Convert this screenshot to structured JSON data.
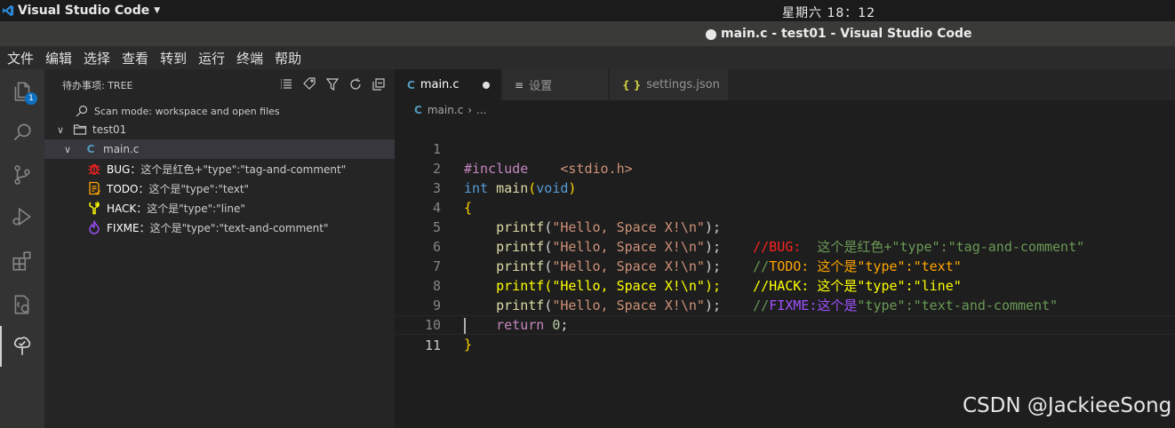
{
  "topbar": {
    "app_name": "Visual Studio Code",
    "clock": "星期六 18：12"
  },
  "window": {
    "title": "main.c - test01 - Visual Studio Code"
  },
  "menu": [
    "文件",
    "编辑",
    "选择",
    "查看",
    "转到",
    "运行",
    "终端",
    "帮助"
  ],
  "activity": {
    "explorer_badge": "1"
  },
  "sidebar": {
    "header": "待办事项: TREE",
    "scan_mode": "Scan mode: workspace and open files",
    "folder": "test01",
    "file": "main.c",
    "items": [
      {
        "tag": "BUG：",
        "text": " 这个是红色+\"type\":\"tag-and-comment\"",
        "color": "#ff2020"
      },
      {
        "tag": "TODO：",
        "text": "这个是\"type\":\"text\"",
        "color": "#ffa500"
      },
      {
        "tag": "HACK：",
        "text": "这个是\"type\":\"line\"",
        "color": "#ffff00"
      },
      {
        "tag": "FIXME：",
        "text": "这个是\"type\":\"text-and-comment\"",
        "color": "#a050ff"
      }
    ]
  },
  "tabs": [
    {
      "icon": "C",
      "label": "main.c",
      "dirty": true
    },
    {
      "icon": "≡",
      "label": "设置",
      "dirty": false
    },
    {
      "icon": "{ }",
      "label": "settings.json",
      "dirty": false
    }
  ],
  "breadcrumb": {
    "file": "main.c",
    "rest": "..."
  },
  "code": {
    "line_numbers": [
      "1",
      "2",
      "3",
      "4",
      "5",
      "6",
      "7",
      "8",
      "9",
      "10",
      "11"
    ],
    "include_kw": "#include",
    "include_file": "<stdio.h>",
    "int_kw": "int",
    "main_fn": "main",
    "void_kw": "void",
    "printf_fn": "printf",
    "hello_str": "\"Hello, Space X!\\n\"",
    "return_kw": "return",
    "zero": "0",
    "c_bug_prefix": "//BUG:",
    "c_bug_body": "  这个是红色+\"type\":\"tag-and-comment\"",
    "c_todo_prefix": "//",
    "c_todo_tag": "TODO:",
    "c_todo_body": " 这个是\"type\":\"text\"",
    "c_hack": "//HACK: 这个是\"type\":\"line\"",
    "c_fixme_prefix": "//",
    "c_fixme_tag": "FIXME:",
    "c_fixme_mid": "这个是",
    "c_fixme_body": "\"type\":\"text-and-comment\""
  },
  "colors": {
    "bug": "#ff2020",
    "todo": "#ffa500",
    "hack": "#ffff00",
    "fixme": "#a050ff"
  },
  "watermark": "CSDN @JackieeSong"
}
